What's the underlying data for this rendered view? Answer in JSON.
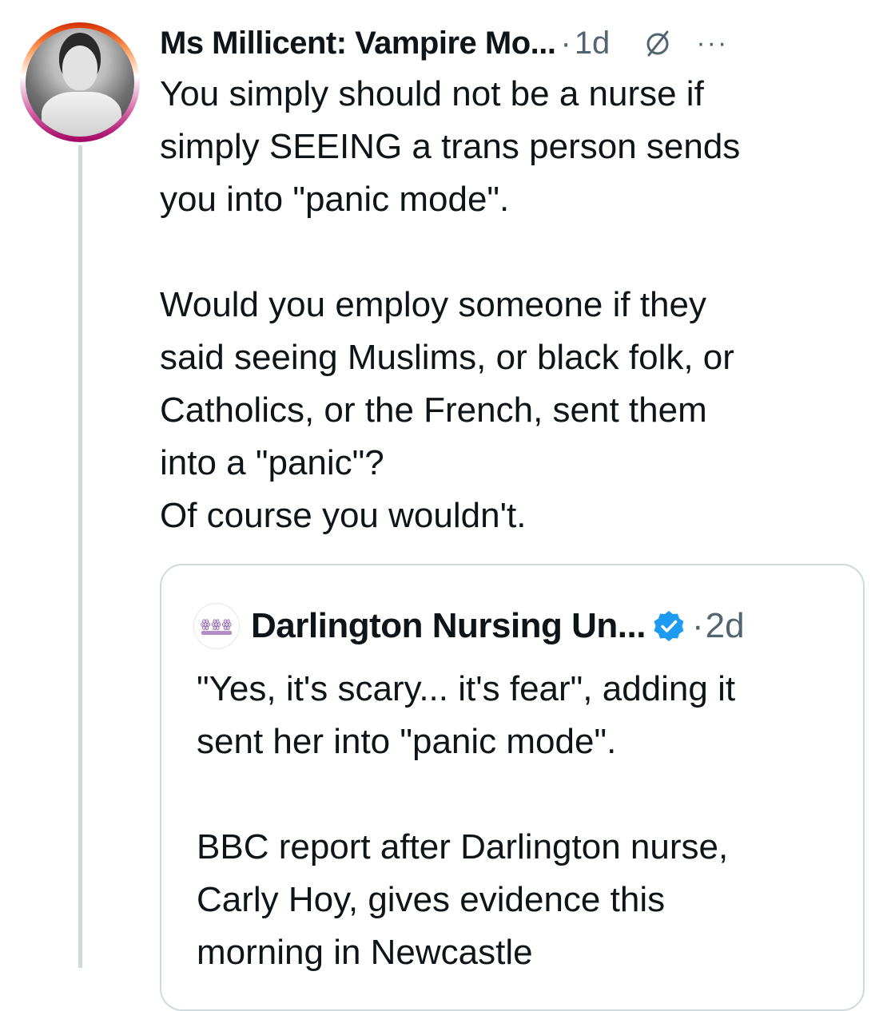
{
  "tweet": {
    "author_name": "Ms Millicent: Vampire Mo...",
    "separator": "·",
    "time": "1d",
    "globe_icon": "globe-slash-icon",
    "more_icon": "more-horizontal-icon",
    "more_label": "···",
    "text": "You simply should not be a nurse if\nsimply SEEING a trans person sends\nyou into \"panic mode\".\n\nWould you employ someone if they\nsaid seeing Muslims, or black folk, or\nCatholics, or the French, sent them\ninto a \"panic\"?\nOf course you wouldn't."
  },
  "quote": {
    "author_name": "Darlington Nursing Un...",
    "verified_icon": "verified-badge-icon",
    "separator": "·",
    "time": "2d",
    "text": "\"Yes, it's scary... it's fear\", adding it\nsent her into \"panic mode\".\n\nBBC report after Darlington nurse,\nCarly Hoy, gives evidence this\nmorning in Newcastle"
  },
  "colors": {
    "text_primary": "#0f1419",
    "text_secondary": "#536471",
    "verified_blue": "#1d9bf0",
    "border": "#cfd9de"
  }
}
